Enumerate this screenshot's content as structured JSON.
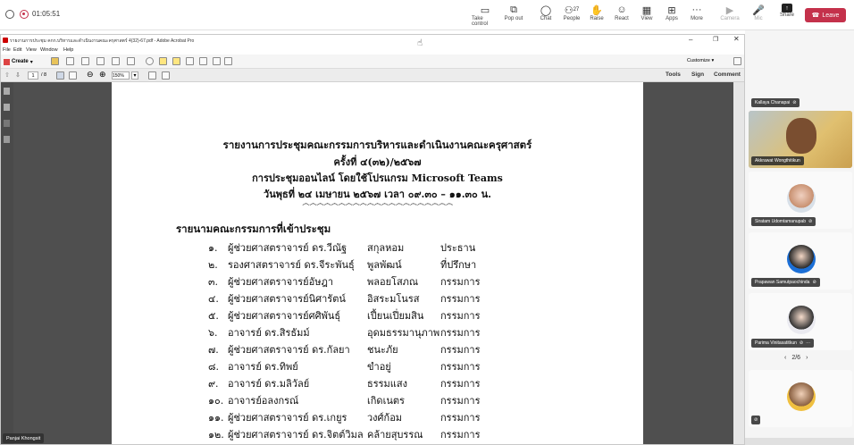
{
  "teams": {
    "timer": "01:05:51",
    "buttons": [
      {
        "label": "Take control",
        "icon": "take-control-icon"
      },
      {
        "label": "Pop out",
        "icon": "pop-out-icon"
      },
      {
        "label": "Chat",
        "icon": "chat-icon"
      },
      {
        "label": "People",
        "icon": "people-icon",
        "count": "27"
      },
      {
        "label": "Raise",
        "icon": "raise-hand-icon"
      },
      {
        "label": "React",
        "icon": "react-icon"
      },
      {
        "label": "View",
        "icon": "view-icon"
      },
      {
        "label": "Apps",
        "icon": "apps-icon"
      },
      {
        "label": "More",
        "icon": "more-icon"
      },
      {
        "label": "Camera",
        "icon": "camera-icon"
      },
      {
        "label": "Mic",
        "icon": "mic-icon"
      },
      {
        "label": "Share",
        "icon": "share-icon"
      }
    ],
    "leave": "Leave"
  },
  "acrobat": {
    "title": "รายงานการประชุม คกก.บริหารและดำเนินงานคณะครุศาสตร์ 4(32)-67.pdf - Adobe Acrobat Pro",
    "menu": [
      "File",
      "Edit",
      "View",
      "Window",
      "Help"
    ],
    "create": "Create",
    "customize": "Customize",
    "page_current": "1",
    "page_total": "/ 8",
    "zoom": "150%",
    "tools": "Tools",
    "sign": "Sign",
    "comment": "Comment"
  },
  "document": {
    "heading": [
      "รายงานการประชุมคณะกรรมการบริหารและดำเนินงานคณะครุศาสตร์",
      "ครั้งที่ ๔(๓๒)/๒๕๖๗",
      "การประชุมออนไลน์ โดยใช้โปรแกรม Microsoft Teams",
      "วันพุธที่ ๒๔ เมษายน ๒๕๖๗ เวลา ๐๙.๓๐ – ๑๑.๓๐ น.",
      "෴෴෴෴෴෴෴෴෴෴෴෴෴෴෴෴෴෴෴෴෴"
    ],
    "section_title": "รายนามคณะกรรมการที่เข้าประชุม",
    "members": [
      {
        "no": "๑.",
        "name": "ผู้ช่วยศาสตราจารย์ ดร.วีณัฐ",
        "surname": "สกุลหอม",
        "role": "ประธาน"
      },
      {
        "no": "๒.",
        "name": "รองศาสตราจารย์ ดร.จีระพันธุ์",
        "surname": "พูลพัฒน์",
        "role": "ที่ปรึกษา"
      },
      {
        "no": "๓.",
        "name": "ผู้ช่วยศาสตราจารย์อัษฎา",
        "surname": "พลอยโสภณ",
        "role": "กรรมการ"
      },
      {
        "no": "๔.",
        "name": "ผู้ช่วยศาสตราจารย์นิศารัตน์",
        "surname": "อิสระมโนรส",
        "role": "กรรมการ"
      },
      {
        "no": "๕.",
        "name": "ผู้ช่วยศาสตราจารย์ศศิพันธุ์",
        "surname": "เปี้ยนเปี่ยมสิน",
        "role": "กรรมการ"
      },
      {
        "no": "๖.",
        "name": "อาจารย์ ดร.สิรธัมม์",
        "surname": "อุดมธรรมานุภาพ",
        "role": "กรรมการ"
      },
      {
        "no": "๗.",
        "name": "ผู้ช่วยศาสตราจารย์ ดร.กัลยา",
        "surname": "ชนะภัย",
        "role": "กรรมการ"
      },
      {
        "no": "๘.",
        "name": "อาจารย์ ดร.ทิพย์",
        "surname": "ขำอยู่",
        "role": "กรรมการ"
      },
      {
        "no": "๙.",
        "name": "อาจารย์ ดร.มลิวัลย์",
        "surname": "ธรรมแสง",
        "role": "กรรมการ"
      },
      {
        "no": "๑๐.",
        "name": "อาจารย์อลงกรณ์",
        "surname": "เกิดเนตร",
        "role": "กรรมการ"
      },
      {
        "no": "๑๑.",
        "name": "ผู้ช่วยศาสตราจารย์ ดร.เกยูร",
        "surname": "วงศ์ก้อม",
        "role": "กรรมการ"
      },
      {
        "no": "๑๒.",
        "name": "ผู้ช่วยศาสตราจารย์ ดร.จิตต์วิมล",
        "surname": "คล้ายสุบรรณ",
        "role": "กรรมการ"
      }
    ]
  },
  "presenter_tag": "Panjai Khongsit",
  "participants": [
    {
      "name": "Kallaya Chanapai"
    },
    {
      "name": "Akkrawat Wongthitikun"
    },
    {
      "name": "Siratam Udomtamanupab"
    },
    {
      "name": "Prapawan Samutpaochinda"
    },
    {
      "name": "Parima Vinitasatitkun"
    }
  ],
  "pagination": "2/6"
}
